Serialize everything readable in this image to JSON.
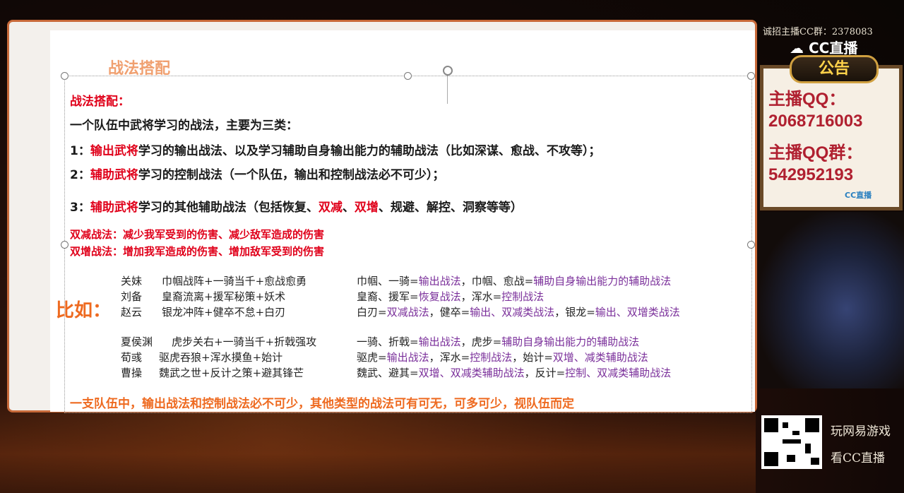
{
  "slide": {
    "title": "战法搭配",
    "heading": "战法搭配：",
    "intro": "一个队伍中武将学习的战法，主要为三类：",
    "item1": {
      "num": "1：",
      "role": "输出武将",
      "text": "学习的输出战法、以及学习辅助自身输出能力的辅助战法（比如深谋、愈战、不攻等）；"
    },
    "item2": {
      "num": "2：",
      "role": "辅助武将",
      "text": "学习的控制战法（一个队伍，输出和控制战法必不可少）；"
    },
    "item3": {
      "num": "3：",
      "role": "辅助武将",
      "text_a": "学习的其他辅助战法（包括恢复、",
      "hl1": "双减",
      "sep": "、",
      "hl2": "双增",
      "text_b": "、规避、解控、洞察等等）"
    },
    "def1": "双减战法：减少我军受到的伤害、减少敌军造成的伤害",
    "def2": "双增战法：增加我军造成的伤害、增加敌军受到的伤害",
    "example_label": "比如：",
    "group1": [
      {
        "name": "关妹",
        "skills": "巾帼战阵+一骑当千+愈战愈勇",
        "a": "巾帼、一骑=",
        "b": "输出战法",
        "c": "，巾帼、愈战=",
        "d": "辅助自身输出能力的辅助战法",
        "e": "",
        "f": ""
      },
      {
        "name": "刘备",
        "skills": "皇裔流离+援军秘策+妖术",
        "a": "皇裔、援军=",
        "b": "恢复战法",
        "c": "，浑水=",
        "d": "控制战法",
        "e": "",
        "f": ""
      },
      {
        "name": "赵云",
        "skills": "银龙冲阵+健卒不怠+白刃",
        "a": "白刃=",
        "b": "双减战法",
        "c": "，健卒=",
        "d": "输出、双减类战法",
        "e": "，银龙=",
        "f": "输出、双增类战法"
      }
    ],
    "group2": [
      {
        "name": "夏侯渊",
        "skills": "虎步关右+一骑当千+折戟强攻",
        "a": "一骑、折戟=",
        "b": "输出战法",
        "c": "，虎步=",
        "d": "辅助自身输出能力的辅助战法",
        "e": "",
        "f": ""
      },
      {
        "name": "荀彧",
        "skills": "驱虎吞狼+浑水摸鱼+始计",
        "a": "驱虎=",
        "b": "输出战法",
        "c": "，浑水=",
        "d": "控制战法",
        "e": "，始计=",
        "f": "双增、减类辅助战法"
      },
      {
        "name": "曹操",
        "skills": "魏武之世+反计之策+避其锋芒",
        "a": "魏武、避其=",
        "b": "双增、双减类辅助战法",
        "c": "，反计=",
        "d": "控制、双减类辅助战法",
        "e": "",
        "f": ""
      }
    ],
    "conclusion": "一支队伍中，输出战法和控制战法必不可少，其他类型的战法可有可无，可多可少，视队伍而定"
  },
  "overlay": {
    "recruit": "诚招主播CC群：2378083",
    "cc_logo": "CC直播",
    "notice_badge": "公告",
    "qq_label": "主播QQ：",
    "qq_value": "2068716003",
    "qq_group_label": "主播QQ群：",
    "qq_group_value": "542952193",
    "cc_mini": "CC直播",
    "slogan1": "玩网易游戏",
    "slogan2": "看CC直播"
  },
  "colors": {
    "frame": "#c86a3a",
    "highlight_red": "#e0001a",
    "accent_orange": "#ee6a20",
    "purple": "#7a2f9a"
  }
}
